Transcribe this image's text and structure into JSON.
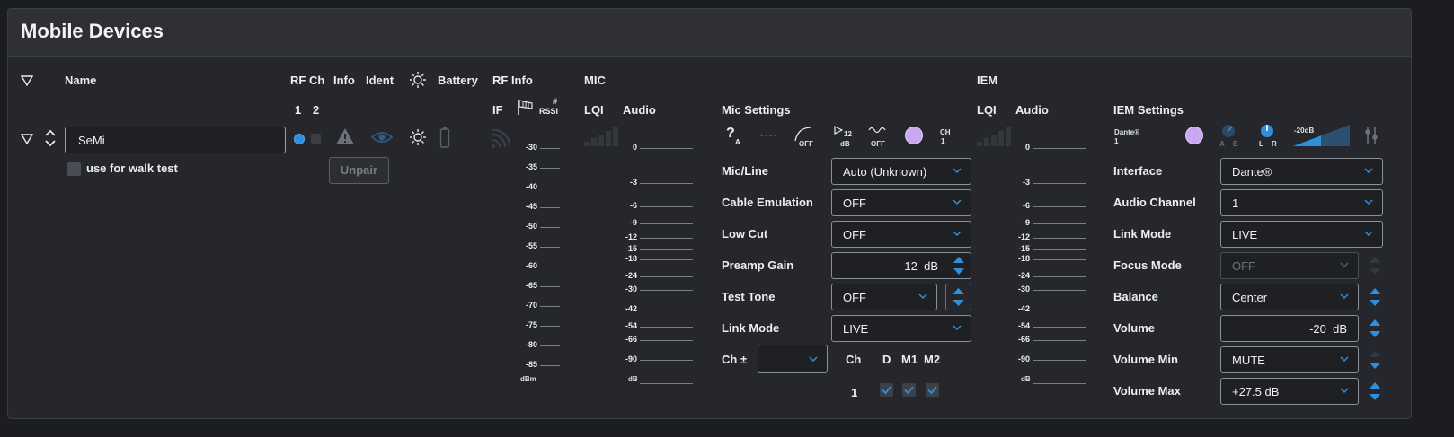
{
  "page": {
    "title": "Mobile Devices"
  },
  "columns": {
    "name": "Name",
    "rf_ch": "RF Ch",
    "info": "Info",
    "ident": "Ident",
    "battery": "Battery",
    "rf_info": "RF Info",
    "mic": "MIC",
    "iem": "IEM",
    "rf_ch_1": "1",
    "rf_ch_2": "2",
    "if": "IF",
    "rssi_hash": "#",
    "rssi": "RSSI",
    "mic_lqi": "LQI",
    "mic_audio": "Audio",
    "mic_settings": "Mic Settings",
    "iem_lqi": "LQI",
    "iem_audio": "Audio",
    "iem_settings": "IEM Settings"
  },
  "device": {
    "name": "SeMi",
    "walk_test_label": "use for walk test",
    "unpair_label": "Unpair"
  },
  "rssi_scale": {
    "labels": [
      "-30",
      "-35",
      "-40",
      "-45",
      "-50",
      "-55",
      "-60",
      "-65",
      "-70",
      "-75",
      "-80",
      "-85"
    ],
    "unit": "dBm"
  },
  "mic_audio_scale": {
    "labels": [
      "0",
      "-3",
      "-6",
      "-9",
      "-12",
      "-15",
      "-18",
      "-24",
      "-30",
      "-42",
      "-54",
      "-66",
      "-90"
    ],
    "unit": "dB"
  },
  "iem_audio_scale": {
    "labels": [
      "0",
      "-3",
      "-6",
      "-9",
      "-12",
      "-15",
      "-18",
      "-24",
      "-30",
      "-42",
      "-54",
      "-66",
      "-90"
    ],
    "unit": "dB"
  },
  "mic_icons": {
    "auto_sub": "A",
    "low_cut_off": "OFF",
    "gain_num": "12",
    "gain_unit": "dB",
    "tone_off": "OFF",
    "ch_label": "CH",
    "ch_num": "1"
  },
  "mic_settings": {
    "mic_line": {
      "label": "Mic/Line",
      "value": "Auto (Unknown)"
    },
    "cable_emulation": {
      "label": "Cable Emulation",
      "value": "OFF"
    },
    "low_cut": {
      "label": "Low Cut",
      "value": "OFF"
    },
    "preamp_gain": {
      "label": "Preamp Gain",
      "value": "12",
      "unit": "dB"
    },
    "test_tone": {
      "label": "Test Tone",
      "value": "OFF"
    },
    "link_mode": {
      "label": "Link Mode",
      "value": "LIVE"
    },
    "ch_pm": {
      "label": "Ch ±",
      "value": ""
    },
    "ch_header": "Ch",
    "d_header": "D",
    "m1_header": "M1",
    "m2_header": "M2",
    "ch_value": "1"
  },
  "iem_icons": {
    "dante": "Dante®",
    "dante_num": "1",
    "ab_a": "A",
    "ab_b": "B",
    "lr_l": "L",
    "lr_r": "R",
    "level": "-20dB"
  },
  "iem_settings": {
    "interface": {
      "label": "Interface",
      "value": "Dante®"
    },
    "audio_channel": {
      "label": "Audio Channel",
      "value": "1"
    },
    "link_mode": {
      "label": "Link Mode",
      "value": "LIVE"
    },
    "focus_mode": {
      "label": "Focus Mode",
      "value": "OFF"
    },
    "balance": {
      "label": "Balance",
      "value": "Center"
    },
    "volume": {
      "label": "Volume",
      "value": "-20",
      "unit": "dB"
    },
    "volume_min": {
      "label": "Volume Min",
      "value": "MUTE"
    },
    "volume_max": {
      "label": "Volume Max",
      "value": "+27.5 dB"
    }
  },
  "colors": {
    "accent": "#2f8fdd",
    "panel": "#25272c",
    "header": "#2e3036",
    "led_lilac": "#c8a8f0"
  }
}
